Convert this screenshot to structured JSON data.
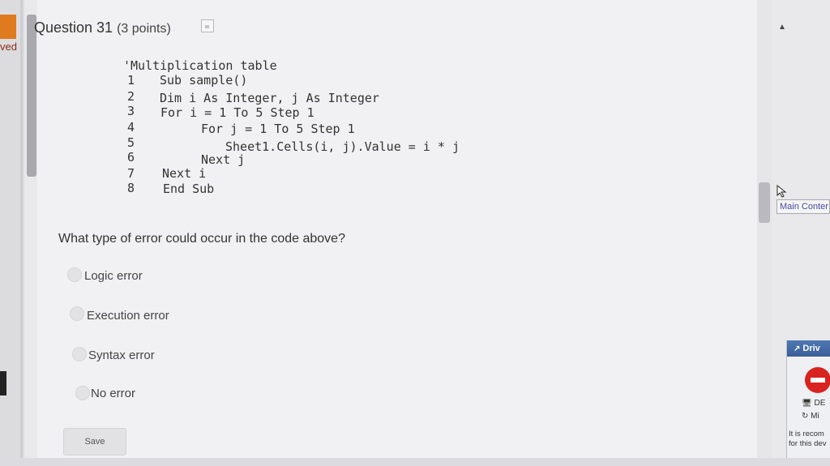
{
  "sidebar": {
    "partial_label": "ved"
  },
  "question": {
    "title": "Question 31",
    "points": "(3 points)",
    "prompt": "What type of error could occur in the code above?"
  },
  "code": {
    "comment": "'Multiplication table",
    "lines": [
      {
        "num": "1",
        "text": "Sub sample()"
      },
      {
        "num": "2",
        "text": "Dim i As Integer, j As Integer"
      },
      {
        "num": "3",
        "text": "For i = 1 To 5 Step 1"
      },
      {
        "num": "4",
        "text": "For j = 1 To 5 Step 1"
      },
      {
        "num": "5",
        "text": "Sheet1.Cells(i, j).Value = i * j"
      },
      {
        "num": "6",
        "text": "Next j"
      },
      {
        "num": "7",
        "text": "Next i"
      },
      {
        "num": "8",
        "text": "End Sub"
      }
    ]
  },
  "options": [
    {
      "label": "Logic error",
      "selected": false
    },
    {
      "label": "Execution error",
      "selected": false
    },
    {
      "label": "Syntax error",
      "selected": false
    },
    {
      "label": "No error",
      "selected": false
    }
  ],
  "footer": {
    "save_label": "Save"
  },
  "right_panel": {
    "main_content_label": "Main Conter",
    "drive_title": "Driv",
    "drive_item_1": "DE",
    "drive_item_2": "Mi",
    "note_line_1": "It is recom",
    "note_line_2": "for this dev"
  },
  "icons": {
    "save": "floppy-disk-icon",
    "stop": "stop-icon",
    "cursor": "mouse-pointer-icon"
  },
  "colors": {
    "accent_orange": "#e07a1f",
    "drive_header": "#4f78b4",
    "stop_red": "#d9231f"
  }
}
